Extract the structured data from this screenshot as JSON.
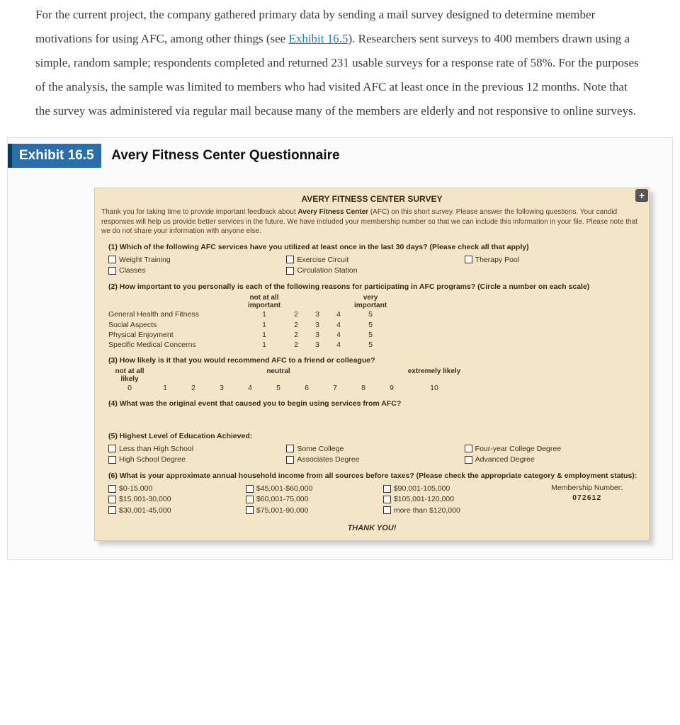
{
  "intro": {
    "text_before_link": "For the current project, the company gathered primary data by sending a mail survey designed to determine member motivations for using AFC, among other things (see ",
    "link_text": "Exhibit 16.5",
    "text_after_link": "). Researchers sent surveys to 400 members drawn using a simple, random sample; respondents completed and returned 231 usable surveys for a response rate of 58%. For the purposes of the analysis, the sample was limited to members who had visited AFC at least once in the previous 12 months. Note that the survey was administered via regular mail because many of the members are elderly and not responsive to online surveys."
  },
  "exhibit": {
    "badge": "Exhibit 16.5",
    "title": "Avery Fitness Center Questionnaire"
  },
  "survey": {
    "title": "AVERY FITNESS CENTER SURVEY",
    "intro_1": "Thank you for taking time to provide important feedback about ",
    "intro_bold": "Avery Fitness Center",
    "intro_2": " (AFC) on this short survey. Please answer the following questions. Your candid responses will help us provide better services in the future. We have included your membership number so that we can include this information in your file. Please note that we do not share your information with anyone else.",
    "q1": {
      "text": "(1) Which of the following AFC services have you utilized at least once in the last 30 days? (Please check all that apply)",
      "options": [
        "Weight Training",
        "Exercise Circuit",
        "Therapy Pool",
        "Classes",
        "Circulation Station"
      ]
    },
    "q2": {
      "text": "(2) How important to you personally is each of the following reasons for participating in AFC programs? (Circle a number on each scale)",
      "low": "not at all important",
      "high": "very important",
      "scale": [
        "1",
        "2",
        "3",
        "4",
        "5"
      ],
      "rows": [
        "General Health and Fitness",
        "Social Aspects",
        "Physical Enjoyment",
        "Specific Medical Concerns"
      ]
    },
    "q3": {
      "text": "(3) How likely is it that you would recommend AFC to a friend or colleague?",
      "low": "not at all likely",
      "mid": "neutral",
      "high": "extremely likely",
      "scale": [
        "0",
        "1",
        "2",
        "3",
        "4",
        "5",
        "6",
        "7",
        "8",
        "9",
        "10"
      ]
    },
    "q4": {
      "text": "(4) What was the original event that caused you to begin using services from AFC?"
    },
    "q5": {
      "text": "(5) Highest Level of Education Achieved:",
      "options": [
        "Less than High School",
        "Some College",
        "Four-year College Degree",
        "High School Degree",
        "Associates Degree",
        "Advanced Degree"
      ]
    },
    "q6": {
      "text": "(6) What is your approximate annual household income from all sources before taxes? (Please check the appropriate category & employment status):",
      "col1": [
        "$0-15,000",
        "$15,001-30,000",
        "$30,001-45,000"
      ],
      "col2": [
        "$45,001-$60,000",
        "$60,001-75,000",
        "$75,001-90,000"
      ],
      "col3": [
        "$90,001-105,000",
        "$105,001-120,000",
        "more than $120,000"
      ],
      "mem_label": "Membership Number:",
      "mem_value": "072612"
    },
    "thank": "THANK YOU!"
  }
}
